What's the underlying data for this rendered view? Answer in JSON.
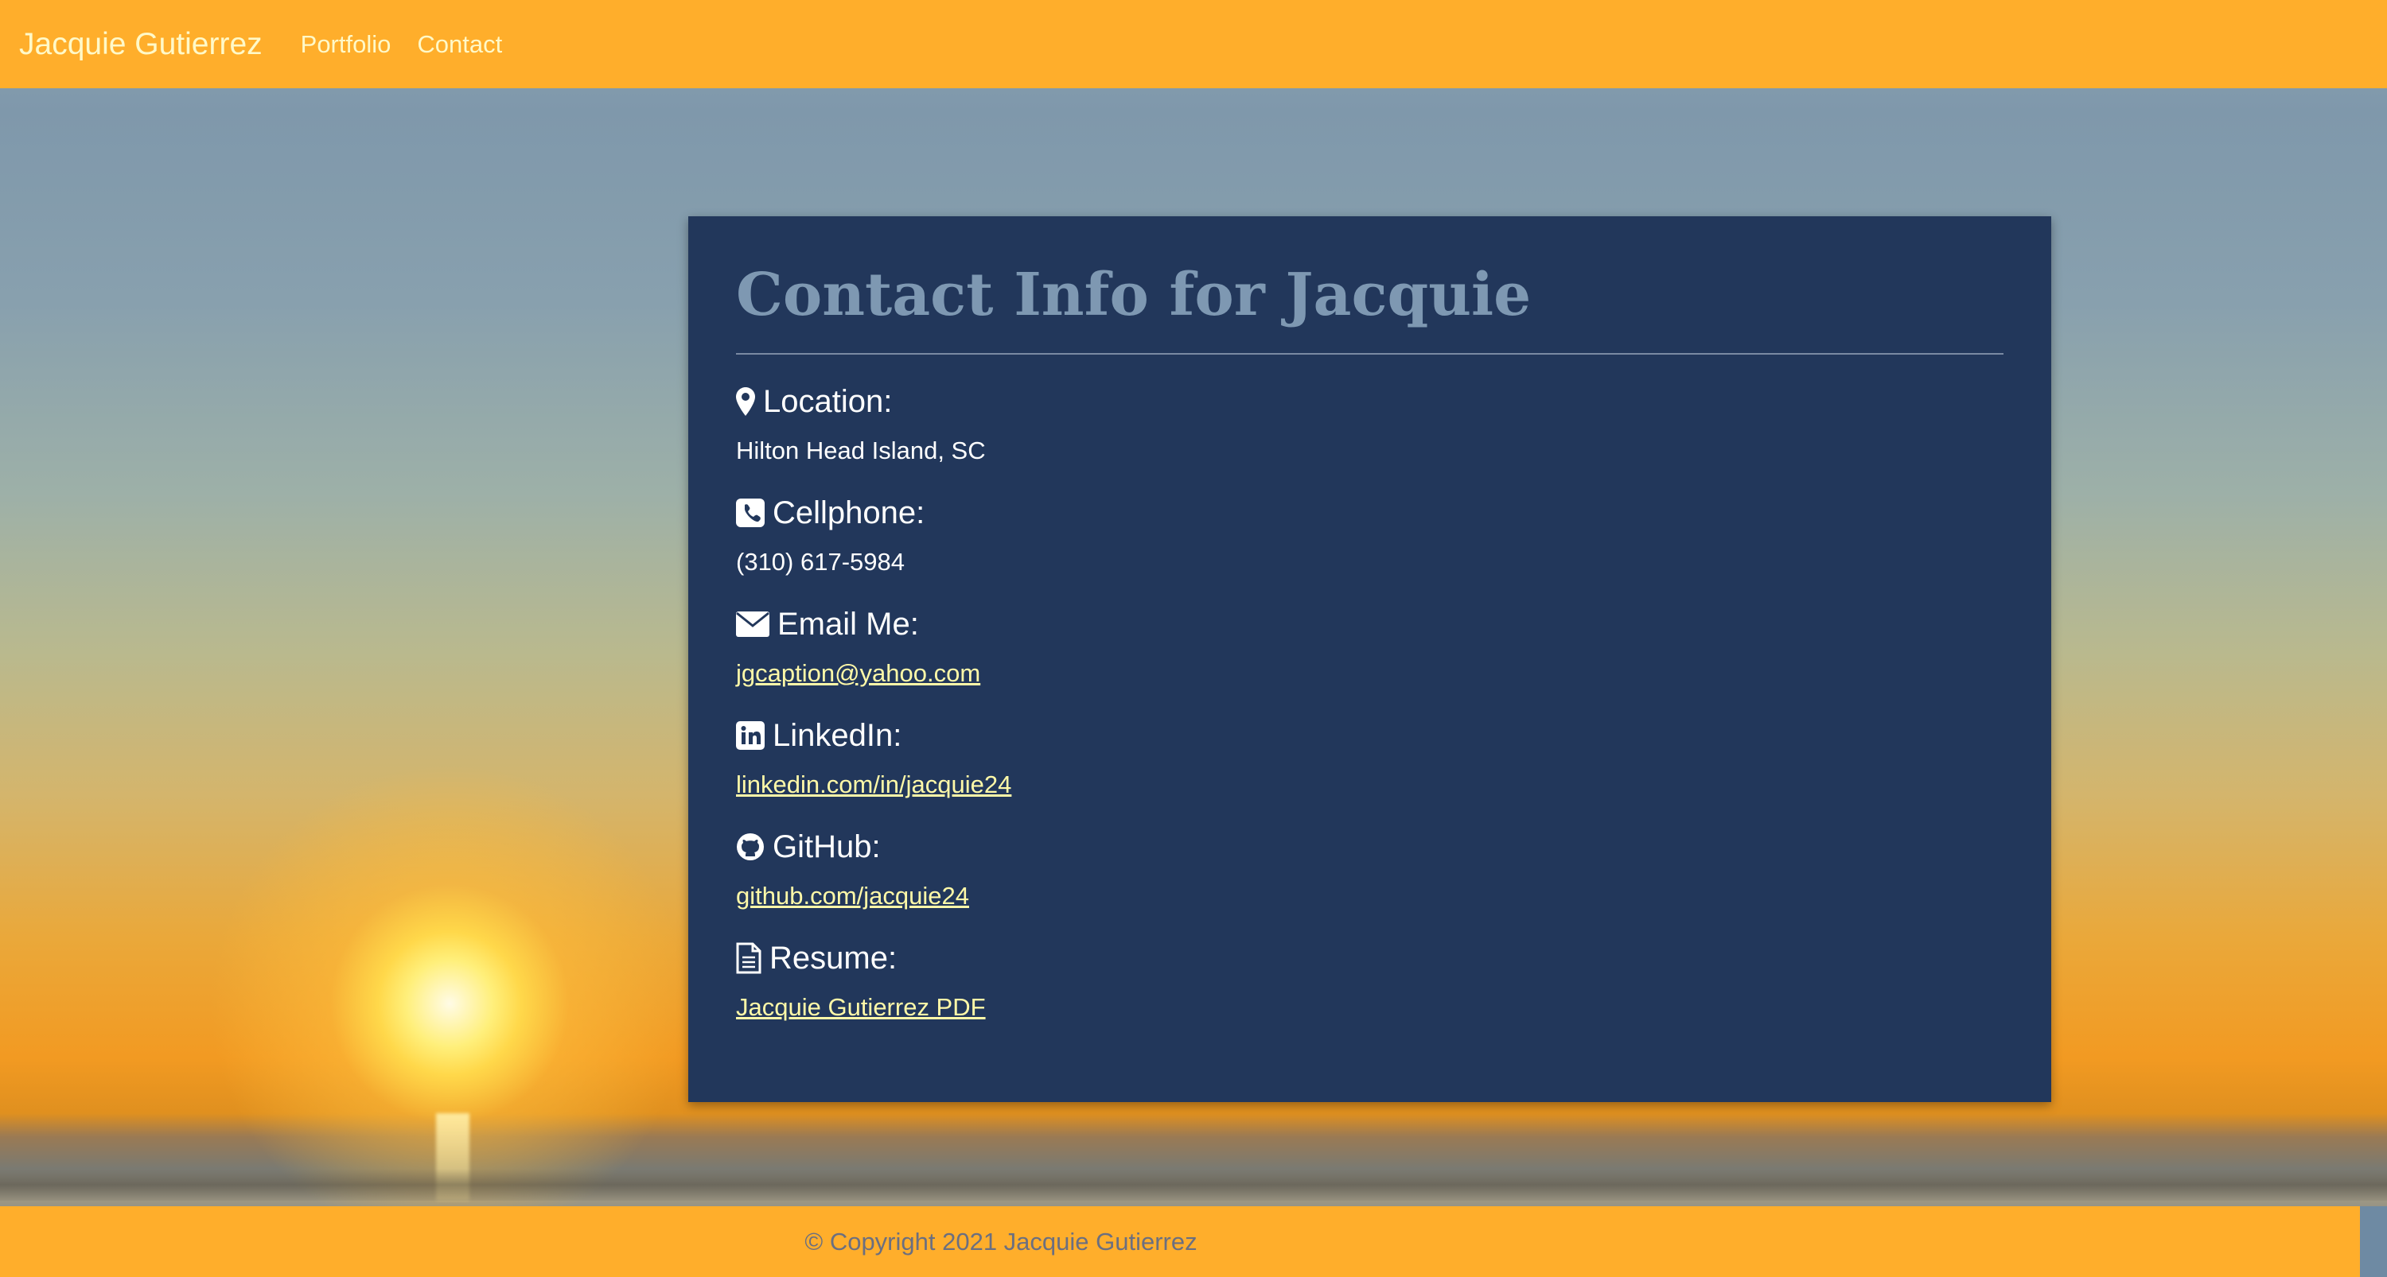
{
  "navbar": {
    "brand": "Jacquie Gutierrez",
    "links": [
      "Portfolio",
      "Contact"
    ]
  },
  "card": {
    "title": "Contact Info for Jacquie",
    "items": [
      {
        "icon": "map-marker-icon",
        "label": "Location:",
        "value": "Hilton Head Island, SC",
        "is_link": false
      },
      {
        "icon": "phone-icon",
        "label": "Cellphone:",
        "value": "(310) 617-5984",
        "is_link": false
      },
      {
        "icon": "envelope-icon",
        "label": "Email Me:",
        "value": "jgcaption@yahoo.com",
        "is_link": true
      },
      {
        "icon": "linkedin-icon",
        "label": "LinkedIn:",
        "value": "linkedin.com/in/jacquie24",
        "is_link": true
      },
      {
        "icon": "github-icon",
        "label": "GitHub:",
        "value": "github.com/jacquie24",
        "is_link": true
      },
      {
        "icon": "file-icon",
        "label": "Resume:",
        "value": "Jacquie Gutierrez PDF",
        "is_link": true
      }
    ]
  },
  "footer": {
    "copyright": "© Copyright 2021 Jacquie Gutierrez"
  },
  "colors": {
    "navbar": "#ffae2b",
    "nav_text": "#fff9c8",
    "card_bg": "#22375b",
    "title": "#7e98b2",
    "link": "#fff9a8",
    "footer_text": "#6b6f80"
  }
}
